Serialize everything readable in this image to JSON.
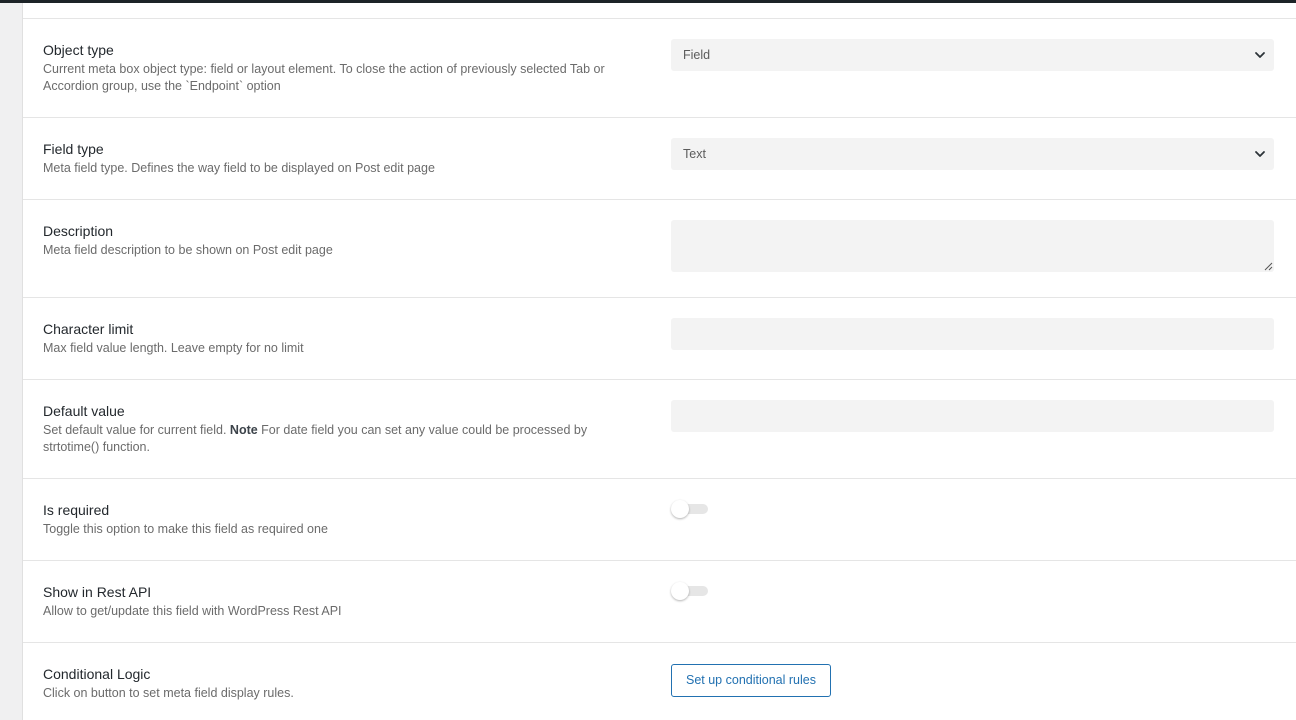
{
  "fields": [
    {
      "label": "Object type",
      "description": "Current meta box object type: field or layout element. To close the action of previously selected Tab or Accordion group, use the `Endpoint` option",
      "control": "select",
      "value": "Field"
    },
    {
      "label": "Field type",
      "description": "Meta field type. Defines the way field to be displayed on Post edit page",
      "control": "select",
      "value": "Text"
    },
    {
      "label": "Description",
      "description": "Meta field description to be shown on Post edit page",
      "control": "textarea",
      "value": ""
    },
    {
      "label": "Character limit",
      "description": "Max field value length. Leave empty for no limit",
      "control": "input",
      "value": ""
    },
    {
      "label": "Default value",
      "description_before": "Set default value for current field. ",
      "description_bold": "Note",
      "description_after": " For date field you can set any value could be processed by strtotime() function.",
      "control": "input",
      "value": ""
    },
    {
      "label": "Is required",
      "description": "Toggle this option to make this field as required one",
      "control": "toggle",
      "enabled": false
    },
    {
      "label": "Show in Rest API",
      "description": "Allow to get/update this field with WordPress Rest API",
      "control": "toggle",
      "enabled": false
    },
    {
      "label": "Conditional Logic",
      "description": "Click on button to set meta field display rules.",
      "control": "button",
      "button_label": "Set up conditional rules"
    }
  ],
  "icons": {
    "dropdown": "chevron-down-icon",
    "resize": "resize-handle-icon"
  },
  "colors": {
    "accent": "#2271b1",
    "field_bg": "#f3f3f3",
    "label": "#23282d",
    "description": "#6b6b6b",
    "divider": "#e5e5e5",
    "topbar": "#1d2327"
  }
}
